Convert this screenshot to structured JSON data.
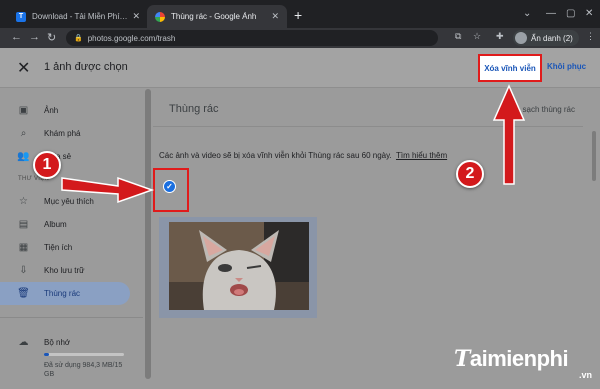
{
  "browser": {
    "tabs": [
      {
        "title": "Download - Tải Miễn Phí VN - Ph",
        "favicon": "T"
      },
      {
        "title": "Thùng rác - Google Ảnh"
      }
    ],
    "url": "photos.google.com/trash",
    "profile_label": "Ẩn danh (2)"
  },
  "appbar": {
    "selection_text": "1 ảnh được chọn",
    "delete_label": "Xóa vĩnh viễn",
    "restore_label": "Khôi phục"
  },
  "sidebar": {
    "items": [
      {
        "label": "Ảnh",
        "icon": "photo-icon"
      },
      {
        "label": "Khám phá",
        "icon": "search-icon"
      },
      {
        "label": "Chia sẻ",
        "icon": "people-icon"
      }
    ],
    "section_library": "THƯ VIỆN",
    "library_items": [
      {
        "label": "Mục yêu thích",
        "icon": "star-icon"
      },
      {
        "label": "Album",
        "icon": "album-icon"
      },
      {
        "label": "Tiện ích",
        "icon": "utilities-icon"
      },
      {
        "label": "Kho lưu trữ",
        "icon": "archive-icon"
      },
      {
        "label": "Thùng rác",
        "icon": "trash-icon",
        "active": true
      }
    ],
    "storage_label": "Bộ nhớ",
    "storage_text": "Đã sử dụng 984,3 MB/15 GB",
    "storage_used_fraction": 0.066
  },
  "main": {
    "title": "Thùng rác",
    "empty_trash": "Dọn sạch thùng rác",
    "info_text": "Các ảnh và video sẽ bị xóa vĩnh viễn khỏi Thùng rác sau 60 ngày.",
    "learn_more": "Tìm hiểu thêm"
  },
  "annotations": {
    "badge1": "1",
    "badge2": "2",
    "color": "#d3191c"
  },
  "watermark": {
    "brand": "aimienphi",
    "brand_t": "T",
    "suffix": ".vn"
  }
}
